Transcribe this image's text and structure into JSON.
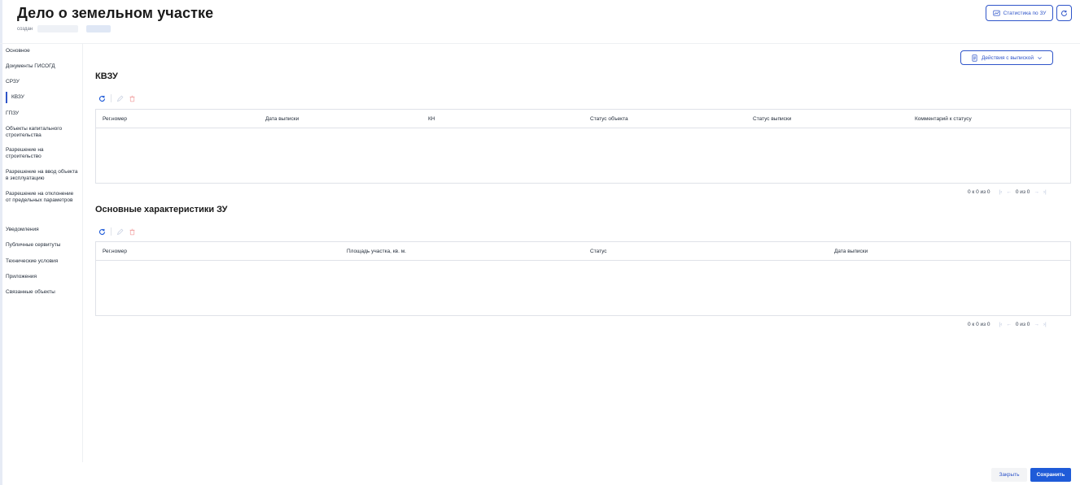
{
  "header": {
    "title": "Дело о земельном участке",
    "created_label": "создан",
    "stats_button": "Статистика по ЗУ"
  },
  "sidebar": {
    "items": [
      {
        "label": "Основное"
      },
      {
        "label": "Документы ГИСОГД"
      },
      {
        "label": "СРЗУ"
      },
      {
        "label": "КВЗУ",
        "active": true
      },
      {
        "label": "ГПЗУ"
      },
      {
        "label": "Объекты капитального строительства"
      },
      {
        "label": "Разрешение на строительство"
      },
      {
        "label": "Разрешение на ввод объекта в эксплуатацию"
      },
      {
        "label": "Разрешение на отклонение от предельных параметров"
      },
      {
        "label": "Уведомления"
      },
      {
        "label": "Публичные сервитуты"
      },
      {
        "label": "Технические условия"
      },
      {
        "label": "Приложения"
      },
      {
        "label": "Связанные объекты"
      }
    ]
  },
  "actions_button": "Действия с выпиской",
  "kvzu": {
    "title": "КВЗУ",
    "columns": [
      "Рег.номер",
      "Дата выписки",
      "КН",
      "Статус объекта",
      "Статус выписки",
      "Комментарий к статусу"
    ],
    "pager_range": "0 к 0 из 0",
    "pager_pages": "0 из 0"
  },
  "main_chars": {
    "title": "Основные характеристики ЗУ",
    "columns": [
      "Рег.номер",
      "Площадь участка, кв. м.",
      "Статус",
      "Дата выписки"
    ],
    "pager_range": "0 к 0 из 0",
    "pager_pages": "0 из 0"
  },
  "footer": {
    "close": "Закрыть",
    "save": "Сохранить"
  },
  "colors": {
    "primary": "#1f5bd8",
    "outline": "#2f55c9",
    "delete": "#f2a5a5"
  },
  "icons": {
    "refresh": "refresh-icon",
    "edit": "pencil-icon",
    "delete": "trash-icon",
    "stats": "chart-icon",
    "actions": "document-icon",
    "chevron": "chevron-down-icon"
  }
}
